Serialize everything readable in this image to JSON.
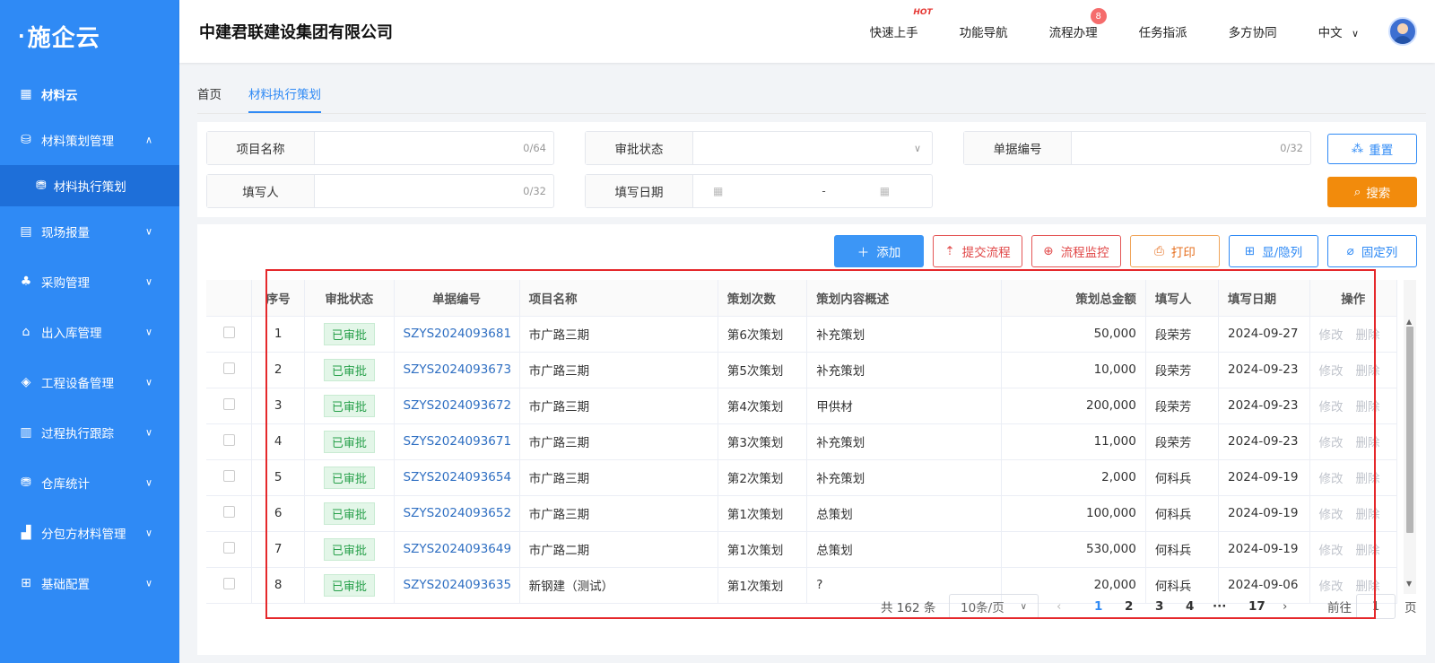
{
  "app": {
    "logo": "施企云",
    "company": "中建君联建设集团有限公司"
  },
  "header": {
    "items": [
      "快速上手",
      "功能导航",
      "流程办理",
      "任务指派",
      "多方协同"
    ],
    "hot_label": "HOT",
    "flow_badge": "8",
    "language": "中文"
  },
  "sidebar": {
    "top": "材料云",
    "items": [
      "材料策划管理",
      "现场报量",
      "采购管理",
      "出入库管理",
      "工程设备管理",
      "过程执行跟踪",
      "仓库统计",
      "分包方材料管理",
      "基础配置"
    ],
    "sub_active": "材料执行策划"
  },
  "tabs": [
    "首页",
    "材料执行策划"
  ],
  "filters": {
    "project_name": {
      "label": "项目名称",
      "count": "0/64"
    },
    "approval_status": {
      "label": "审批状态"
    },
    "doc_no": {
      "label": "单据编号",
      "count": "0/32"
    },
    "filler": {
      "label": "填写人",
      "count": "0/32"
    },
    "fill_date": {
      "label": "填写日期",
      "sep": "-"
    },
    "reset": "重置",
    "search": "搜索"
  },
  "toolbar": {
    "add": "添加",
    "submit": "提交流程",
    "monitor": "流程监控",
    "print": "打印",
    "toggle_cols": "显/隐列",
    "fix_cols": "固定列"
  },
  "table": {
    "headers": [
      "序号",
      "审批状态",
      "单据编号",
      "项目名称",
      "策划次数",
      "策划内容概述",
      "策划总金额",
      "填写人",
      "填写日期",
      "操作"
    ],
    "edit": "修改",
    "delete": "删除",
    "rows": [
      {
        "no": "1",
        "status": "已审批",
        "doc": "SZYS2024093681",
        "project": "市广路三期",
        "times": "第6次策划",
        "summary": "补充策划",
        "amount": "50,000",
        "filler": "段荣芳",
        "date": "2024-09-27"
      },
      {
        "no": "2",
        "status": "已审批",
        "doc": "SZYS2024093673",
        "project": "市广路三期",
        "times": "第5次策划",
        "summary": "补充策划",
        "amount": "10,000",
        "filler": "段荣芳",
        "date": "2024-09-23"
      },
      {
        "no": "3",
        "status": "已审批",
        "doc": "SZYS2024093672",
        "project": "市广路三期",
        "times": "第4次策划",
        "summary": "甲供材",
        "amount": "200,000",
        "filler": "段荣芳",
        "date": "2024-09-23"
      },
      {
        "no": "4",
        "status": "已审批",
        "doc": "SZYS2024093671",
        "project": "市广路三期",
        "times": "第3次策划",
        "summary": "补充策划",
        "amount": "11,000",
        "filler": "段荣芳",
        "date": "2024-09-23"
      },
      {
        "no": "5",
        "status": "已审批",
        "doc": "SZYS2024093654",
        "project": "市广路三期",
        "times": "第2次策划",
        "summary": "补充策划",
        "amount": "2,000",
        "filler": "何科兵",
        "date": "2024-09-19"
      },
      {
        "no": "6",
        "status": "已审批",
        "doc": "SZYS2024093652",
        "project": "市广路三期",
        "times": "第1次策划",
        "summary": "总策划",
        "amount": "100,000",
        "filler": "何科兵",
        "date": "2024-09-19"
      },
      {
        "no": "7",
        "status": "已审批",
        "doc": "SZYS2024093649",
        "project": "市广路二期",
        "times": "第1次策划",
        "summary": "总策划",
        "amount": "530,000",
        "filler": "何科兵",
        "date": "2024-09-19"
      },
      {
        "no": "8",
        "status": "已审批",
        "doc": "SZYS2024093635",
        "project": "新钢建（测试）",
        "times": "第1次策划",
        "summary": "?",
        "amount": "20,000",
        "filler": "何科兵",
        "date": "2024-09-06"
      }
    ]
  },
  "pagination": {
    "total": "共 162 条",
    "page_size": "10条/页",
    "pages": [
      "1",
      "2",
      "3",
      "4",
      "···",
      "17"
    ],
    "goto": "前往",
    "goto_value": "1",
    "page_unit": "页"
  },
  "colors": {
    "brand": "#2f8af5",
    "danger": "#e04545",
    "warning": "#f28b0c",
    "success": "#27a04a",
    "highlight": "#e5282b"
  }
}
